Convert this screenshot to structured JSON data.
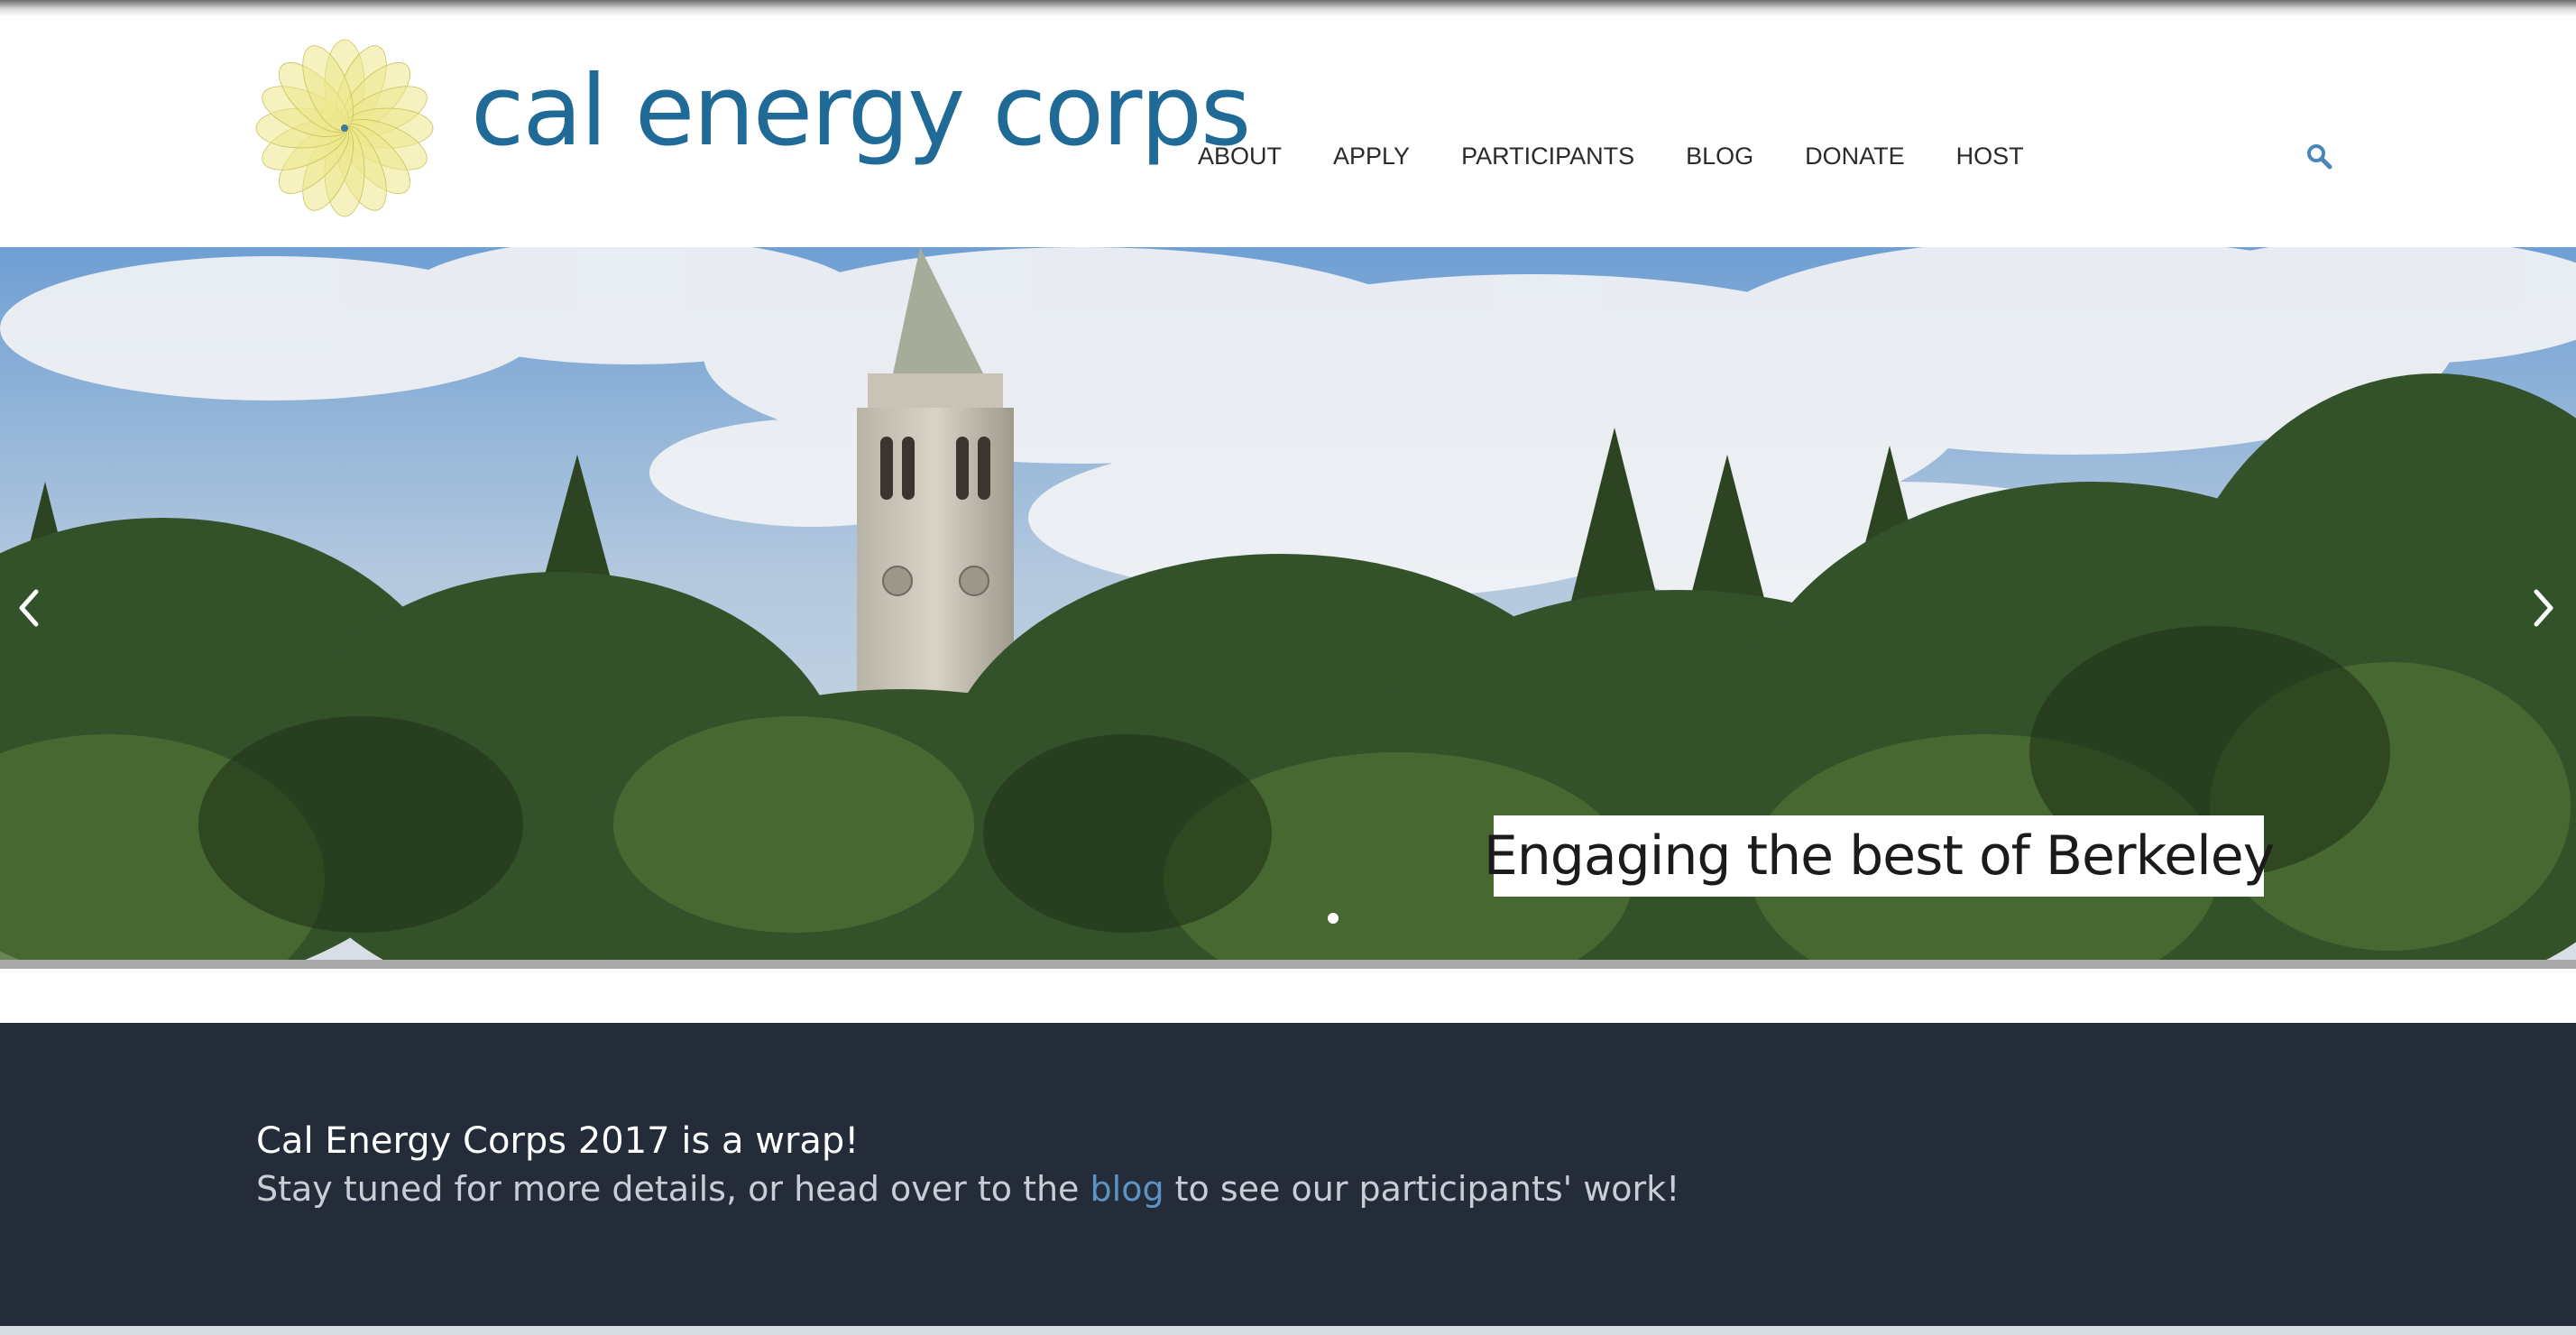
{
  "brand": {
    "name": "cal energy corps",
    "logo_color": "#1f6a96",
    "flower_color": "#e8e38a"
  },
  "nav": {
    "items": [
      {
        "label": "ABOUT"
      },
      {
        "label": "APPLY"
      },
      {
        "label": "PARTICIPANTS"
      },
      {
        "label": "BLOG"
      },
      {
        "label": "DONATE"
      },
      {
        "label": "HOST"
      }
    ],
    "search_icon": "search-icon"
  },
  "hero": {
    "caption": "Engaging the best of Berkeley",
    "slide_count": 1,
    "active_slide": 1,
    "prev_icon": "chevron-left-icon",
    "next_icon": "chevron-right-icon"
  },
  "announcement": {
    "title": "Cal Energy Corps 2017 is a wrap!",
    "line_before_link": "Stay tuned for more details, or head over to the ",
    "link_text": "blog",
    "line_after_link": " to see our participants' work!",
    "background": "#232c38",
    "link_color": "#5b93c4"
  }
}
